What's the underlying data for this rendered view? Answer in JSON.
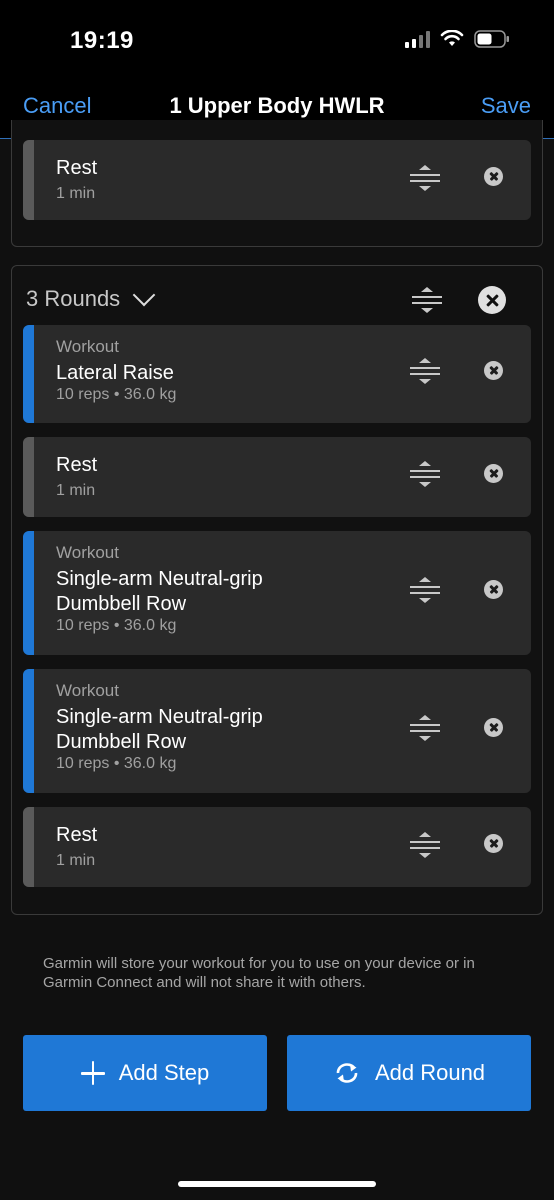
{
  "status_bar": {
    "time": "19:19"
  },
  "nav": {
    "cancel_label": "Cancel",
    "title": "1 Upper Body HWLR",
    "save_label": "Save"
  },
  "top_group": {
    "steps": [
      {
        "type": "rest",
        "name": "Rest",
        "detail": "1 min"
      }
    ]
  },
  "round_group": {
    "header": "3 Rounds",
    "steps": [
      {
        "type": "workout",
        "type_label": "Workout",
        "name": "Lateral Raise",
        "detail": "10 reps • 36.0 kg"
      },
      {
        "type": "rest",
        "name": "Rest",
        "detail": "1 min"
      },
      {
        "type": "workout",
        "type_label": "Workout",
        "name_line1": "Single-arm Neutral-grip",
        "name_line2": "Dumbbell Row",
        "detail": "10 reps • 36.0 kg"
      },
      {
        "type": "workout",
        "type_label": "Workout",
        "name_line1": "Single-arm Neutral-grip",
        "name_line2": "Dumbbell Row",
        "detail": "10 reps • 36.0 kg"
      },
      {
        "type": "rest",
        "name": "Rest",
        "detail": "1 min"
      }
    ]
  },
  "note": "Garmin will store your workout for you to use on your device or in Garmin Connect and will not share it with others.",
  "actions": {
    "add_step_label": "Add Step",
    "add_round_label": "Add Round"
  },
  "colors": {
    "accent": "#1f78d6",
    "link": "#4a9df5",
    "rest_bar": "#5a5a5a"
  }
}
